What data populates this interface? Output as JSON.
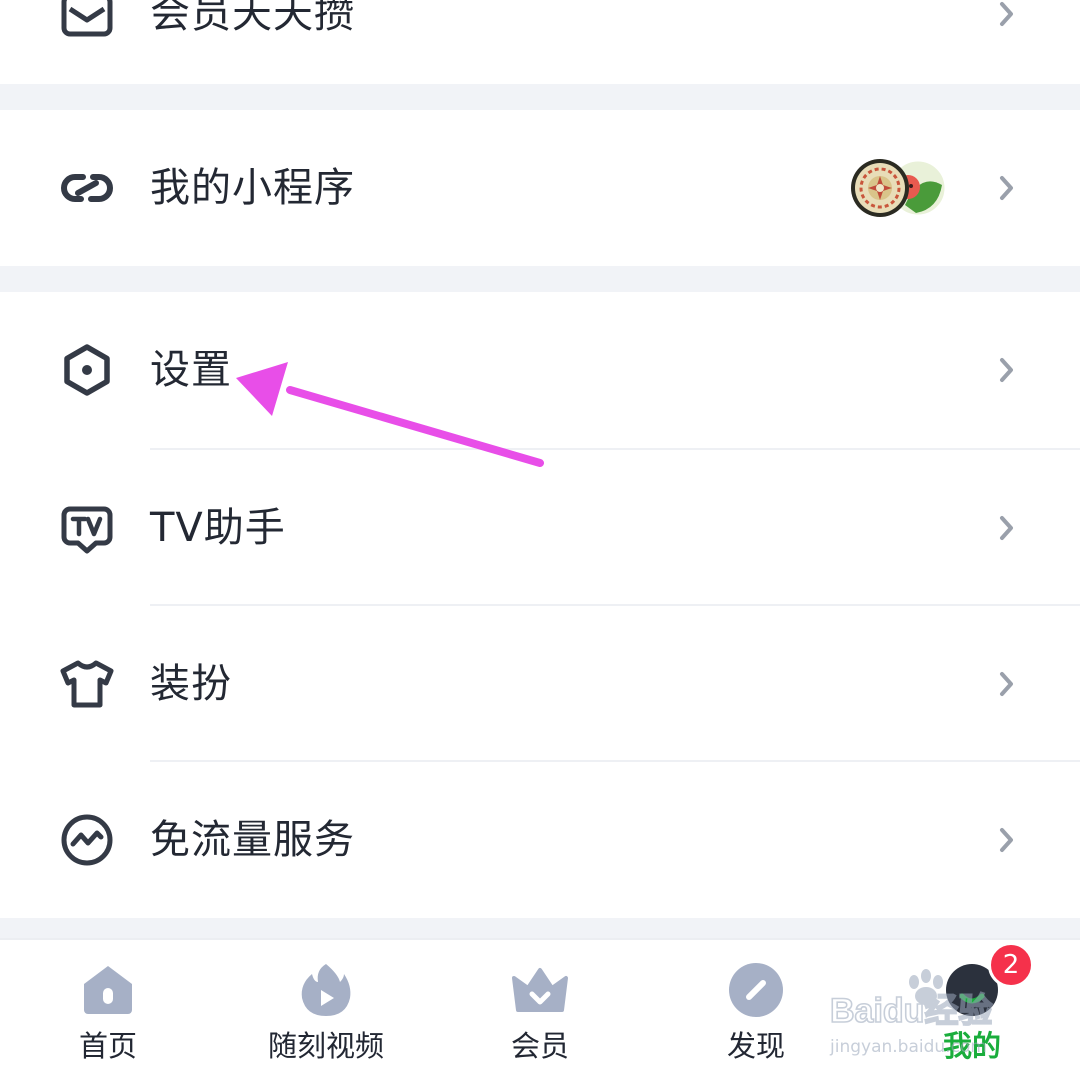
{
  "menu": {
    "partial_item": {
      "label": "会员天天攒",
      "icon": "mail-icon"
    },
    "mini_program": {
      "label": "我的小程序",
      "icon": "link-icon",
      "apps": [
        "mandala-app-icon",
        "watermelon-app-icon"
      ]
    },
    "settings": {
      "label": "设置",
      "icon": "hexagon-settings-icon"
    },
    "tv_assistant": {
      "label": "TV助手",
      "icon": "tv-icon"
    },
    "dress_up": {
      "label": "装扮",
      "icon": "tshirt-icon"
    },
    "free_data": {
      "label": "免流量服务",
      "icon": "pulse-circle-icon"
    }
  },
  "annotation": {
    "color": "#e84ee8"
  },
  "tabbar": {
    "tabs": [
      {
        "label": "首页",
        "icon": "home-icon",
        "active": false
      },
      {
        "label": "随刻视频",
        "icon": "flame-play-icon",
        "active": false
      },
      {
        "label": "会员",
        "icon": "crown-icon",
        "active": false
      },
      {
        "label": "发现",
        "icon": "compass-icon",
        "active": false
      },
      {
        "label": "我的",
        "icon": "avatar-icon",
        "active": true,
        "badge": "2"
      }
    ],
    "active_color": "#1aad3c",
    "icon_color": "#a6b0c6"
  },
  "watermark": {
    "logo": "Baidu经验",
    "url": "jingyan.baidu.com"
  }
}
